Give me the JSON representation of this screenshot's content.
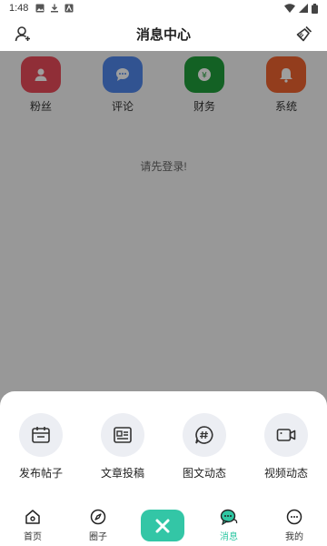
{
  "status_bar": {
    "time": "1:48"
  },
  "header": {
    "title": "消息中心"
  },
  "categories": [
    {
      "label": "粉丝",
      "icon": "fans-icon",
      "color": "#e84b5a"
    },
    {
      "label": "评论",
      "icon": "comment-icon",
      "color": "#4f86ea"
    },
    {
      "label": "财务",
      "icon": "finance-icon",
      "color": "#1f9d3a"
    },
    {
      "label": "系统",
      "icon": "system-bell-icon",
      "color": "#ee6330"
    }
  ],
  "login_tip": "请先登录!",
  "publish_actions": [
    {
      "label": "发布帖子",
      "icon": "post-icon"
    },
    {
      "label": "文章投稿",
      "icon": "article-icon"
    },
    {
      "label": "图文动态",
      "icon": "hashtag-icon"
    },
    {
      "label": "视频动态",
      "icon": "video-icon"
    }
  ],
  "tabbar": {
    "items": [
      {
        "label": "首页",
        "icon": "home-icon"
      },
      {
        "label": "圈子",
        "icon": "compass-icon"
      },
      {
        "label": "消息",
        "icon": "message-icon",
        "active": true
      },
      {
        "label": "我的",
        "icon": "profile-icon"
      }
    ],
    "accent": "#2ec7a3"
  }
}
